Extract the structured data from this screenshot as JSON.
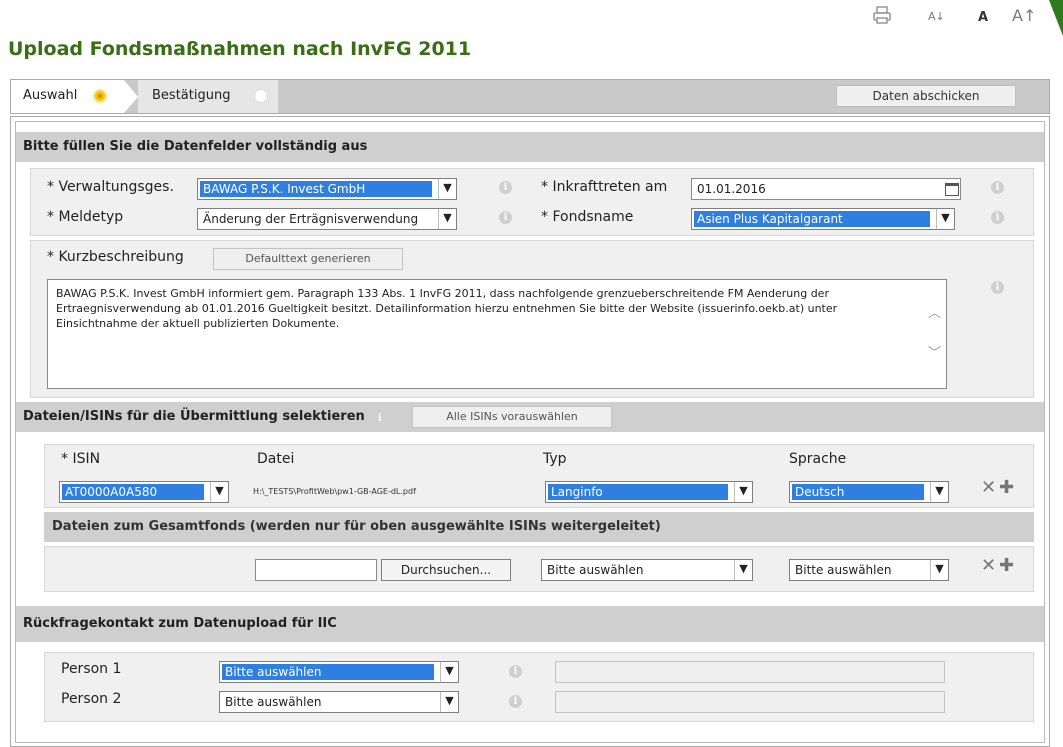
{
  "toolbar": {
    "print_icon": "printer-icon",
    "font_smaller": "A↓",
    "font_normal": "A",
    "font_larger": "A↑"
  },
  "page": {
    "title": "Upload Fondsmaßnahmen nach InvFG 2011"
  },
  "steps": [
    {
      "label": "Auswahl",
      "active": true
    },
    {
      "label": "Bestätigung",
      "active": false
    }
  ],
  "send_button": "Daten abschicken",
  "section_main": {
    "heading": "Bitte füllen Sie die Datenfelder vollständig aus"
  },
  "fields": {
    "verwaltungsges": {
      "label": "Verwaltungsges.",
      "value": "BAWAG P.S.K. Invest GmbH"
    },
    "meldetyp": {
      "label": "Meldetyp",
      "value": "Änderung der Erträgnisverwendung"
    },
    "inkrafttreten": {
      "label": "Inkrafttreten am",
      "value": "01.01.2016"
    },
    "fondsname": {
      "label": "Fondsname",
      "value": "Asien Plus Kapitalgarant"
    },
    "required_mark": "*"
  },
  "kurzbeschreibung": {
    "label": "Kurzbeschreibung",
    "button": "Defaulttext generieren",
    "text": "BAWAG P.S.K. Invest GmbH informiert gem. Paragraph 133 Abs. 1 InvFG 2011, dass nachfolgende grenzueberschreitende FM Aenderung der Ertraegnisverwendung ab 01.01.2016 Gueltigkeit besitzt. Detailinformation hierzu entnehmen Sie bitte der Website (issuerinfo.oekb.at) unter Einsichtnahme der aktuell publizierten Dokumente."
  },
  "files_section": {
    "heading": "Dateien/ISINs für die Übermittlung selektieren",
    "preselect_button": "Alle ISINs vorauswählen",
    "columns": {
      "isin": "ISIN",
      "datei": "Datei",
      "typ": "Typ",
      "sprache": "Sprache"
    },
    "row": {
      "isin": "AT0000A0A580",
      "datei": "H:\\_TESTS\\ProfitWeb\\pw1-GB-AGE-dL.pdf",
      "typ": "Langinfo",
      "sprache": "Deutsch"
    },
    "gesamtfonds_heading": "Dateien zum Gesamtfonds (werden nur für oben ausgewählte ISINs weitergeleitet)",
    "browse_button": "Durchsuchen...",
    "gesamt_typ": "Bitte auswählen",
    "gesamt_sprache": "Bitte auswählen"
  },
  "contact_section": {
    "heading": "Rückfragekontakt zum Datenupload für IIC",
    "person1": {
      "label": "Person 1",
      "value": "Bitte auswählen"
    },
    "person2": {
      "label": "Person 2",
      "value": "Bitte auswählen"
    }
  },
  "icons": {
    "info": "i",
    "remove": "✕",
    "add": "✚",
    "dropdown": "▼"
  }
}
